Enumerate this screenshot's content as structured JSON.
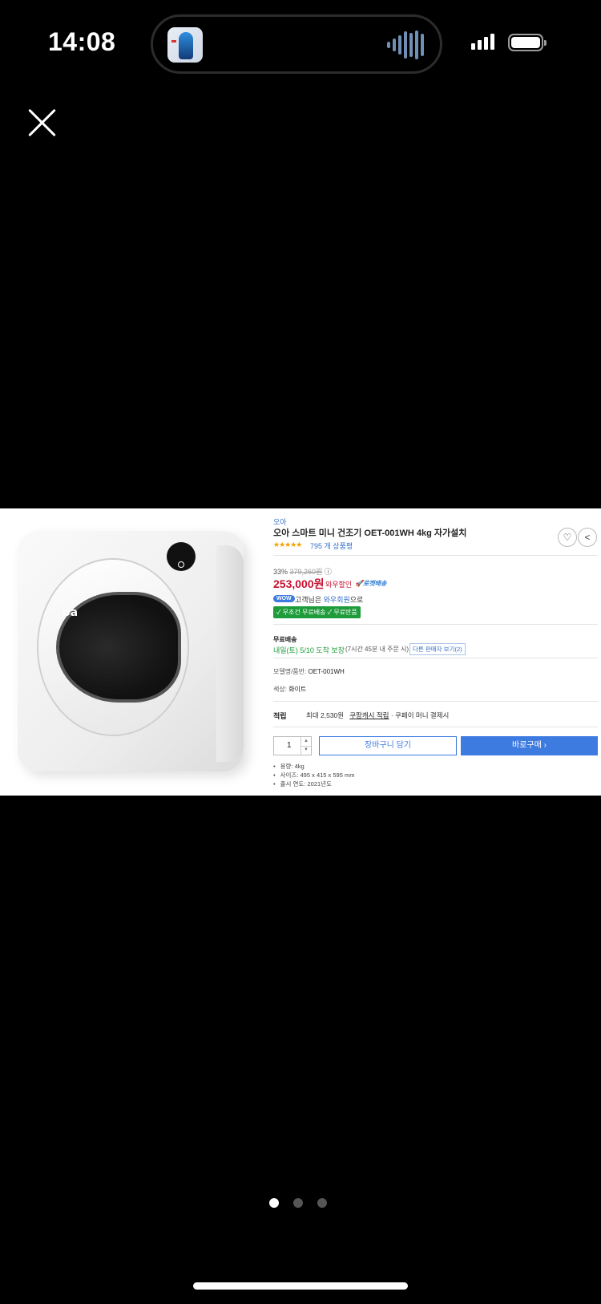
{
  "status_bar": {
    "time": "14:08"
  },
  "viewer": {
    "close_icon": "close-icon",
    "page_indicator": {
      "count": 3,
      "active_index": 0
    }
  },
  "product": {
    "brand": "오아",
    "title": "오아 스마트 미니 건조기 OET-001WH 4kg 자가설치",
    "rating_stars": "★★★★★",
    "rating": 4.5,
    "reviews": "795 개 상품평",
    "discount_pct": "33%",
    "original_price": "379,260원",
    "price": "253,000원",
    "price_note": "와우할인",
    "rocket_label": "🚀로켓배송",
    "wow_badge": "WOW",
    "wow_text_pre": "고객님은",
    "wow_text_link": "와우회원",
    "wow_text_post": "으로",
    "green_box": "✓ 무조건 무료배송 ✓ 무료반품",
    "ship_head": "무료배송",
    "ship_date": "내일(토) 5/10 도착 보장",
    "ship_extra": "(7시간 45분 내 주문 시)",
    "seller_link": "다른 판매자 보기(2)",
    "model_label": "모델명/품번:",
    "model_value": "OET-001WH",
    "color_label": "색상:",
    "color_value": "화이트",
    "reward_head": "적립",
    "reward_pre": "최대 2,530원",
    "reward_link": "쿠팡캐시 적립",
    "reward_post": "· 쿠페이 머니 결제시",
    "quantity": "1",
    "cart_label": "장바구니 담기",
    "buy_label": "바로구매 ›",
    "specs": [
      "용량: 4kg",
      "사이즈: 495 x 415 x 595 mm",
      "출시 연도: 2021년도"
    ],
    "heart_icon": "♡",
    "share_icon": "<"
  },
  "dryer_logo": "oa"
}
